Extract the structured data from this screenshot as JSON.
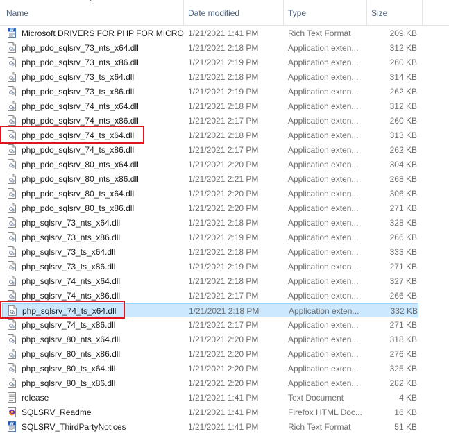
{
  "columns": {
    "name": "Name",
    "date": "Date modified",
    "type": "Type",
    "size": "Size"
  },
  "colors": {
    "highlight": "#e0141e",
    "selection": "#cce8ff"
  },
  "files": [
    {
      "name": "Microsoft DRIVERS FOR PHP FOR MICRO...",
      "date": "1/21/2021 1:41 PM",
      "type": "Rich Text Format",
      "size": "209 KB",
      "icon": "wordpad-document-icon"
    },
    {
      "name": "php_pdo_sqlsrv_73_nts_x64.dll",
      "date": "1/21/2021 2:18 PM",
      "type": "Application exten...",
      "size": "312 KB",
      "icon": "dll-file-icon"
    },
    {
      "name": "php_pdo_sqlsrv_73_nts_x86.dll",
      "date": "1/21/2021 2:19 PM",
      "type": "Application exten...",
      "size": "260 KB",
      "icon": "dll-file-icon"
    },
    {
      "name": "php_pdo_sqlsrv_73_ts_x64.dll",
      "date": "1/21/2021 2:18 PM",
      "type": "Application exten...",
      "size": "314 KB",
      "icon": "dll-file-icon"
    },
    {
      "name": "php_pdo_sqlsrv_73_ts_x86.dll",
      "date": "1/21/2021 2:19 PM",
      "type": "Application exten...",
      "size": "262 KB",
      "icon": "dll-file-icon"
    },
    {
      "name": "php_pdo_sqlsrv_74_nts_x64.dll",
      "date": "1/21/2021 2:18 PM",
      "type": "Application exten...",
      "size": "312 KB",
      "icon": "dll-file-icon"
    },
    {
      "name": "php_pdo_sqlsrv_74_nts_x86.dll",
      "date": "1/21/2021 2:17 PM",
      "type": "Application exten...",
      "size": "260 KB",
      "icon": "dll-file-icon"
    },
    {
      "name": "php_pdo_sqlsrv_74_ts_x64.dll",
      "date": "1/21/2021 2:18 PM",
      "type": "Application exten...",
      "size": "313 KB",
      "icon": "dll-file-icon",
      "highlighted": true
    },
    {
      "name": "php_pdo_sqlsrv_74_ts_x86.dll",
      "date": "1/21/2021 2:17 PM",
      "type": "Application exten...",
      "size": "262 KB",
      "icon": "dll-file-icon"
    },
    {
      "name": "php_pdo_sqlsrv_80_nts_x64.dll",
      "date": "1/21/2021 2:20 PM",
      "type": "Application exten...",
      "size": "304 KB",
      "icon": "dll-file-icon"
    },
    {
      "name": "php_pdo_sqlsrv_80_nts_x86.dll",
      "date": "1/21/2021 2:21 PM",
      "type": "Application exten...",
      "size": "268 KB",
      "icon": "dll-file-icon"
    },
    {
      "name": "php_pdo_sqlsrv_80_ts_x64.dll",
      "date": "1/21/2021 2:20 PM",
      "type": "Application exten...",
      "size": "306 KB",
      "icon": "dll-file-icon"
    },
    {
      "name": "php_pdo_sqlsrv_80_ts_x86.dll",
      "date": "1/21/2021 2:20 PM",
      "type": "Application exten...",
      "size": "271 KB",
      "icon": "dll-file-icon"
    },
    {
      "name": "php_sqlsrv_73_nts_x64.dll",
      "date": "1/21/2021 2:18 PM",
      "type": "Application exten...",
      "size": "328 KB",
      "icon": "dll-file-icon"
    },
    {
      "name": "php_sqlsrv_73_nts_x86.dll",
      "date": "1/21/2021 2:19 PM",
      "type": "Application exten...",
      "size": "266 KB",
      "icon": "dll-file-icon"
    },
    {
      "name": "php_sqlsrv_73_ts_x64.dll",
      "date": "1/21/2021 2:18 PM",
      "type": "Application exten...",
      "size": "333 KB",
      "icon": "dll-file-icon"
    },
    {
      "name": "php_sqlsrv_73_ts_x86.dll",
      "date": "1/21/2021 2:19 PM",
      "type": "Application exten...",
      "size": "271 KB",
      "icon": "dll-file-icon"
    },
    {
      "name": "php_sqlsrv_74_nts_x64.dll",
      "date": "1/21/2021 2:18 PM",
      "type": "Application exten...",
      "size": "327 KB",
      "icon": "dll-file-icon"
    },
    {
      "name": "php_sqlsrv_74_nts_x86.dll",
      "date": "1/21/2021 2:17 PM",
      "type": "Application exten...",
      "size": "266 KB",
      "icon": "dll-file-icon"
    },
    {
      "name": "php_sqlsrv_74_ts_x64.dll",
      "date": "1/21/2021 2:18 PM",
      "type": "Application exten...",
      "size": "332 KB",
      "icon": "dll-file-icon",
      "highlighted": true,
      "selected": true
    },
    {
      "name": "php_sqlsrv_74_ts_x86.dll",
      "date": "1/21/2021 2:17 PM",
      "type": "Application exten...",
      "size": "271 KB",
      "icon": "dll-file-icon"
    },
    {
      "name": "php_sqlsrv_80_nts_x64.dll",
      "date": "1/21/2021 2:20 PM",
      "type": "Application exten...",
      "size": "318 KB",
      "icon": "dll-file-icon"
    },
    {
      "name": "php_sqlsrv_80_nts_x86.dll",
      "date": "1/21/2021 2:20 PM",
      "type": "Application exten...",
      "size": "276 KB",
      "icon": "dll-file-icon"
    },
    {
      "name": "php_sqlsrv_80_ts_x64.dll",
      "date": "1/21/2021 2:20 PM",
      "type": "Application exten...",
      "size": "325 KB",
      "icon": "dll-file-icon"
    },
    {
      "name": "php_sqlsrv_80_ts_x86.dll",
      "date": "1/21/2021 2:20 PM",
      "type": "Application exten...",
      "size": "282 KB",
      "icon": "dll-file-icon"
    },
    {
      "name": "release",
      "date": "1/21/2021 1:41 PM",
      "type": "Text Document",
      "size": "4 KB",
      "icon": "text-document-icon"
    },
    {
      "name": "SQLSRV_Readme",
      "date": "1/21/2021 1:41 PM",
      "type": "Firefox HTML Doc...",
      "size": "16 KB",
      "icon": "firefox-html-icon"
    },
    {
      "name": "SQLSRV_ThirdPartyNotices",
      "date": "1/21/2021 1:41 PM",
      "type": "Rich Text Format",
      "size": "51 KB",
      "icon": "wordpad-document-icon"
    }
  ]
}
